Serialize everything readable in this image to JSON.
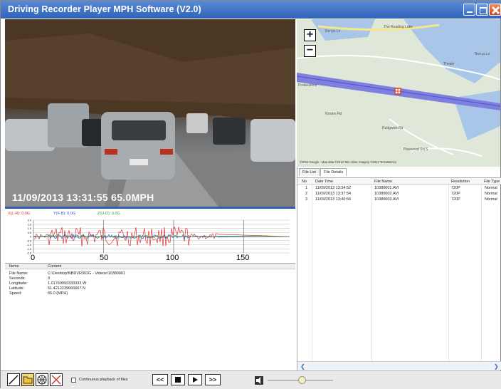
{
  "window": {
    "title": "Driving Recorder Player MPH Software (V2.0)"
  },
  "video": {
    "overlay": "11/09/2013 13:31:55  65.0MPH"
  },
  "graph": {
    "legend": [
      {
        "label": "X(L-R): 0.0G",
        "color": "#e03030"
      },
      {
        "label": "Y(F-B): 0.0G",
        "color": "#3050e0"
      },
      {
        "label": "Z(U-D): 0.0G",
        "color": "#30a030"
      }
    ],
    "y_ticks": [
      "2.0",
      "1.5",
      "1.0",
      "0.5",
      "0",
      "-0.5",
      "-1.0",
      "-1.5",
      "-2.0"
    ],
    "x_ticks": [
      "0",
      "50",
      "100",
      "150"
    ]
  },
  "info": {
    "headers": {
      "items": "Items",
      "content": "Content"
    },
    "rows": [
      {
        "item": "File Name:",
        "value": "C:\\Desktop\\NBDVR302G - Videos\\10380001"
      },
      {
        "item": "Seconds:",
        "value": "3"
      },
      {
        "item": "Longitude:",
        "value": "1.01769993333333 W"
      },
      {
        "item": "Latitude:",
        "value": "51.4212239666667 N"
      },
      {
        "item": "Speed:",
        "value": "65.0 (MPH)"
      }
    ]
  },
  "map": {
    "zoom_in": "+",
    "zoom_out": "−",
    "labels": [
      "Berrys Ln",
      "The Reading Lake",
      "Berrys Ln",
      "Theale",
      "Productions",
      "Kirsten Rd",
      "Rudgwick Rd",
      "Pinewood Rd S"
    ],
    "copyright": "©2013 Google - Map data ©2013 Tele Atlas, Imagery ©2013 TerraMetrics"
  },
  "files": {
    "tabs": [
      "File List",
      "File Details"
    ],
    "columns": [
      "No",
      "Date Time",
      "File Name",
      "Resolution",
      "File Type"
    ],
    "rows": [
      {
        "no": "1",
        "datetime": "11/09/2013 13:34:52",
        "name": "10380001.AVI",
        "res": "720P",
        "type": "Normal"
      },
      {
        "no": "2",
        "datetime": "11/09/2013 13:37:54",
        "name": "10380002.AVI",
        "res": "720P",
        "type": "Normal"
      },
      {
        "no": "3",
        "datetime": "11/09/2013 13:40:56",
        "name": "10380003.AVI",
        "res": "720P",
        "type": "Normal"
      }
    ]
  },
  "toolbar": {
    "continuous_label": "Continuous playback of files",
    "prev": "<<",
    "next": ">>"
  }
}
